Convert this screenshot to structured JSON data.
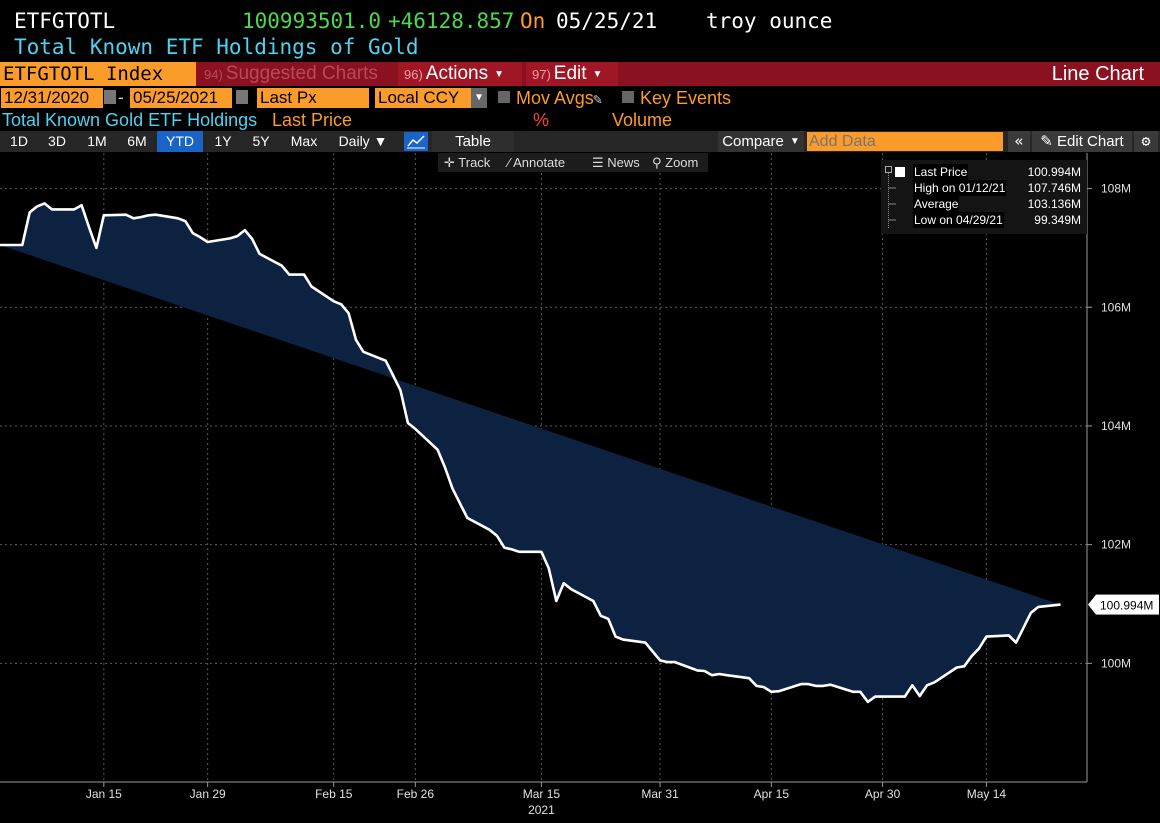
{
  "header": {
    "ticker": "ETFGTOTL",
    "last_value": "100993501.0",
    "change": "+46128.857",
    "on_label": "On",
    "date": "05/25/21",
    "unit": "troy ounce",
    "subtitle": "Total Known ETF Holdings of Gold"
  },
  "toolbar": {
    "security": "ETFGTOTL Index",
    "suggested": {
      "num": "94)",
      "label": "Suggested Charts"
    },
    "actions": {
      "num": "96)",
      "label": "Actions"
    },
    "edit": {
      "num": "97)",
      "label": "Edit"
    },
    "view_label": "Line Chart"
  },
  "settings": {
    "start_date": "12/31/2020",
    "end_date": "05/25/2021",
    "date_sep": "-",
    "field": "Last Px",
    "currency": "Local CCY",
    "mov_avgs": "Mov Avgs",
    "key_events": "Key Events"
  },
  "columns": {
    "series_name": "Total Known Gold ETF Holdings",
    "last_price": "Last Price",
    "pct": "%",
    "volume": "Volume"
  },
  "periods": [
    "1D",
    "3D",
    "1M",
    "6M",
    "YTD",
    "1Y",
    "5Y",
    "Max"
  ],
  "selected_period": "YTD",
  "frequency": "Daily ▼",
  "table_label": "Table",
  "compare_label": "Compare",
  "add_data_placeholder": "Add Data",
  "edit_chart_label": "Edit Chart",
  "tools": {
    "track": "Track",
    "annotate": "Annotate",
    "news": "News",
    "zoom": "Zoom"
  },
  "legend": {
    "last_price": {
      "label": "Last Price",
      "value": "100.994M"
    },
    "high": {
      "label": "High on 01/12/21",
      "value": "107.746M"
    },
    "average": {
      "label": "Average",
      "value": "103.136M"
    },
    "low": {
      "label": "Low on 04/29/21",
      "value": "99.349M"
    }
  },
  "colors": {
    "line": "#ffffff",
    "fill": "#0c2240",
    "accent_orange": "#fb9b2a",
    "accent_green": "#4dd84d",
    "accent_cyan": "#4fd2f0",
    "bar_red": "#8a1220"
  },
  "chart_data": {
    "type": "area",
    "x_unit": "2021 trading days (Jan 1 = day 1)",
    "x": [
      1,
      4,
      5,
      6,
      7,
      8,
      11,
      12,
      13,
      14,
      15,
      18,
      19,
      20,
      21,
      22,
      25,
      26,
      27,
      28,
      29,
      32,
      33,
      34,
      35,
      36,
      39,
      40,
      41,
      42,
      43,
      46,
      47,
      48,
      49,
      50,
      53,
      54,
      55,
      56,
      57,
      60,
      61,
      62,
      63,
      64,
      67,
      68,
      69,
      70,
      71,
      74,
      75,
      76,
      77,
      78,
      81,
      82,
      83,
      84,
      85,
      88,
      89,
      90,
      91,
      92,
      95,
      96,
      97,
      98,
      99,
      102,
      103,
      104,
      105,
      106,
      109,
      110,
      111,
      112,
      113,
      116,
      117,
      118,
      119,
      120,
      123,
      124,
      125,
      126,
      127,
      130,
      131,
      132,
      133,
      134,
      137,
      138,
      139,
      140,
      141,
      144,
      145
    ],
    "values": [
      107.05,
      107.05,
      107.6,
      107.7,
      107.75,
      107.65,
      107.65,
      107.72,
      107.35,
      107.0,
      107.55,
      107.56,
      107.5,
      107.52,
      107.55,
      107.56,
      107.5,
      107.45,
      107.25,
      107.18,
      107.1,
      107.16,
      107.2,
      107.3,
      107.15,
      106.9,
      106.7,
      106.55,
      106.55,
      106.55,
      106.35,
      106.1,
      106.05,
      105.9,
      105.45,
      105.25,
      105.1,
      104.85,
      104.6,
      104.05,
      103.95,
      103.6,
      103.3,
      102.95,
      102.7,
      102.45,
      102.25,
      102.15,
      101.95,
      101.92,
      101.88,
      101.88,
      101.6,
      101.05,
      101.35,
      101.25,
      101.05,
      100.8,
      100.75,
      100.45,
      100.4,
      100.35,
      100.2,
      100.05,
      100.02,
      100.02,
      99.88,
      99.87,
      99.8,
      99.82,
      99.8,
      99.75,
      99.62,
      99.6,
      99.52,
      99.53,
      99.65,
      99.65,
      99.62,
      99.62,
      99.64,
      99.52,
      99.52,
      99.35,
      99.44,
      99.44,
      99.44,
      99.63,
      99.45,
      99.63,
      99.68,
      99.93,
      99.95,
      100.12,
      100.25,
      100.45,
      100.47,
      100.35,
      100.6,
      100.85,
      100.95,
      100.99
    ],
    "ylim": [
      98.0,
      108.6
    ],
    "y_ticks": [
      {
        "value": 108,
        "label": "108M"
      },
      {
        "value": 106,
        "label": "106M"
      },
      {
        "value": 104,
        "label": "104M"
      },
      {
        "value": 102,
        "label": "102M"
      },
      {
        "value": 100,
        "label": "100M"
      }
    ],
    "x_ticks": [
      {
        "x": 15,
        "label": "Jan 15"
      },
      {
        "x": 29,
        "label": "Jan 29"
      },
      {
        "x": 46,
        "label": "Feb 15"
      },
      {
        "x": 57,
        "label": "Feb 26"
      },
      {
        "x": 74,
        "label": "Mar 15"
      },
      {
        "x": 90,
        "label": "Mar 31"
      },
      {
        "x": 105,
        "label": "Apr 15"
      },
      {
        "x": 120,
        "label": "Apr 30"
      },
      {
        "x": 134,
        "label": "May 14"
      }
    ],
    "year_label": "2021",
    "last_label": "100.994M",
    "grid": true
  }
}
